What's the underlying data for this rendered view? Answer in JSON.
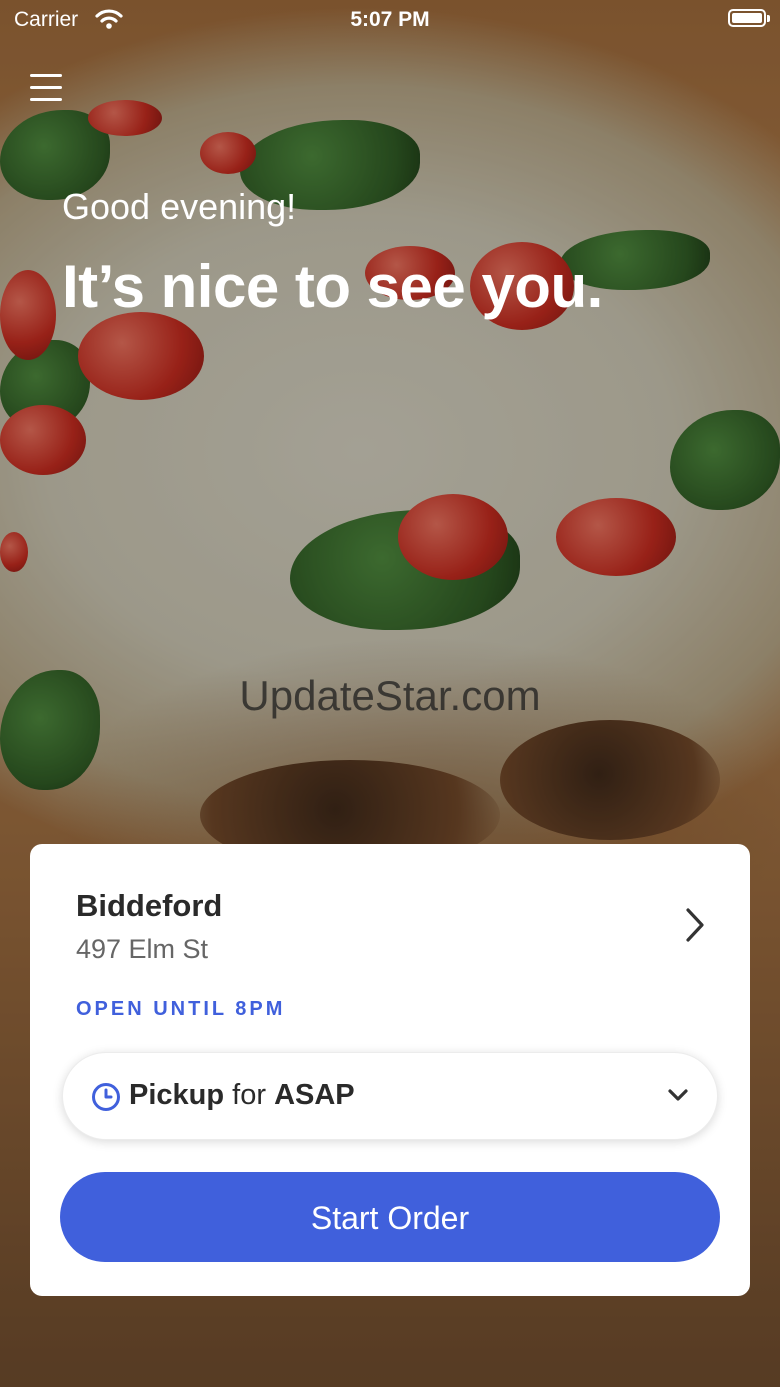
{
  "status_bar": {
    "carrier": "Carrier",
    "time": "5:07 PM"
  },
  "hero": {
    "greeting": "Good evening!",
    "headline": "It’s nice to see you."
  },
  "watermark": "UpdateStar.com",
  "store": {
    "name": "Biddeford",
    "address": "497 Elm St",
    "hours": "OPEN UNTIL 8PM"
  },
  "order_mode": {
    "mode": "Pickup",
    "connector": "for",
    "time": "ASAP"
  },
  "actions": {
    "start_order": "Start Order"
  },
  "colors": {
    "accent": "#4060dc"
  },
  "icons": [
    "wifi-icon",
    "battery-icon",
    "menu-icon",
    "chevron-right-icon",
    "clock-icon",
    "chevron-down-icon"
  ]
}
